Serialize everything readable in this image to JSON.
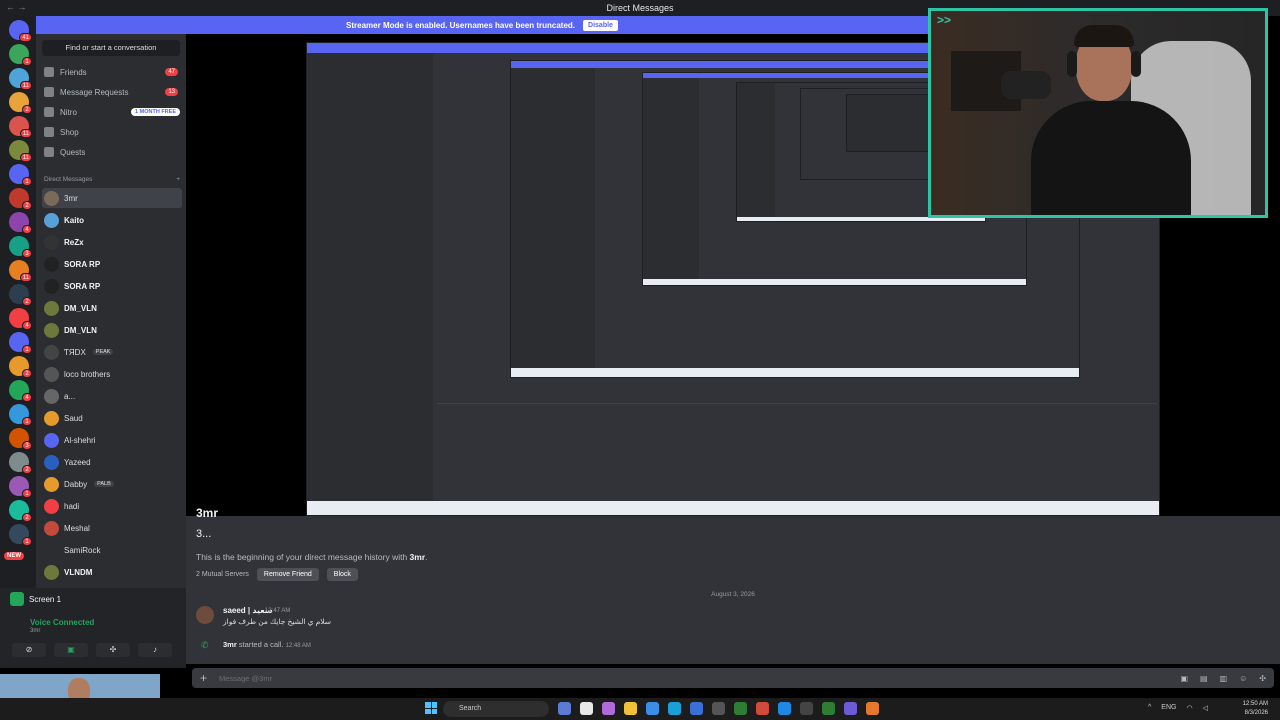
{
  "window": {
    "title": "Direct Messages",
    "nav": "← →",
    "controls": [
      "—",
      "☐",
      "✕"
    ]
  },
  "banner": {
    "text": "Streamer Mode is enabled. Usernames have been truncated.",
    "button": "Disable"
  },
  "rail": {
    "badges": [
      "41",
      "1",
      "11",
      "2",
      "11",
      "11",
      "1",
      "2",
      "4",
      "3",
      "11",
      "2",
      "4",
      "1",
      "2",
      "4",
      "1",
      "3",
      "2",
      "1",
      "2",
      "1"
    ],
    "new_label": "NEW"
  },
  "sidebar": {
    "search_placeholder": "Find or start a conversation",
    "nav": [
      {
        "label": "Friends",
        "badge": "47"
      },
      {
        "label": "Message Requests",
        "badge": "13"
      },
      {
        "label": "Nitro",
        "pill": "1 MONTH FREE"
      },
      {
        "label": "Shop"
      },
      {
        "label": "Quests"
      }
    ],
    "dm_header": "Direct Messages",
    "dm_add": "+",
    "dms": [
      {
        "name": "3mr",
        "bold": false,
        "active": true,
        "color": "#7a6a5a"
      },
      {
        "name": "Kaito",
        "bold": true,
        "color": "#5aa0d8"
      },
      {
        "name": "ReZx",
        "bold": true,
        "color": "#333"
      },
      {
        "name": "SORA RP",
        "bold": true,
        "color": "#222"
      },
      {
        "name": "SORA RP",
        "bold": true,
        "color": "#222"
      },
      {
        "name": "DM_VLN",
        "bold": true,
        "color": "#6b7a3a"
      },
      {
        "name": "DM_VLN",
        "bold": true,
        "color": "#6b7a3a"
      },
      {
        "name": "ƬЯDX",
        "tag": "PEAK",
        "color": "#444"
      },
      {
        "name": "loco brothers",
        "color": "#555"
      },
      {
        "name": "a...",
        "color": "#666"
      },
      {
        "name": "Saud",
        "color": "#e69a2b"
      },
      {
        "name": "Al-shehri",
        "color": "#5865f2"
      },
      {
        "name": "Yazeed",
        "color": "#2a5fc2"
      },
      {
        "name": "Dabby",
        "tag": "PALB",
        "color": "#e69a2b"
      },
      {
        "name": "hadi",
        "color": "#f23f43"
      },
      {
        "name": "Meshal",
        "color": "#c24a3a"
      },
      {
        "name": "SamiRock",
        "color": "#2b2d31"
      },
      {
        "name": "VLNDM",
        "bold": true,
        "color": "#6b7a3a"
      }
    ]
  },
  "voice": {
    "screen_label": "Screen 1",
    "status": "Voice Connected",
    "channel": "3mr"
  },
  "chat": {
    "title": "3mr",
    "subtitle": "3...",
    "beginning_prefix": "This is the beginning of your direct message history with ",
    "beginning_name": "3mr",
    "beginning_suffix": ".",
    "mutual": "2 Mutual Servers",
    "remove_friend": "Remove Friend",
    "block": "Block",
    "date": "August 3, 2026",
    "message": {
      "author": "saeed | سعيد",
      "time": "12:47 AM",
      "text": "سلام ي الشيخ جايك من طرف فواز"
    },
    "call": {
      "who": "3mr",
      "action": " started a call.",
      "time": "12:48 AM"
    },
    "input_placeholder": "Message @3mr"
  },
  "taskbar": {
    "search": "Search",
    "lang": "ENG",
    "time": "12:50 AM",
    "date": "8/3/2026"
  },
  "cam": {
    "tag": ">>"
  }
}
